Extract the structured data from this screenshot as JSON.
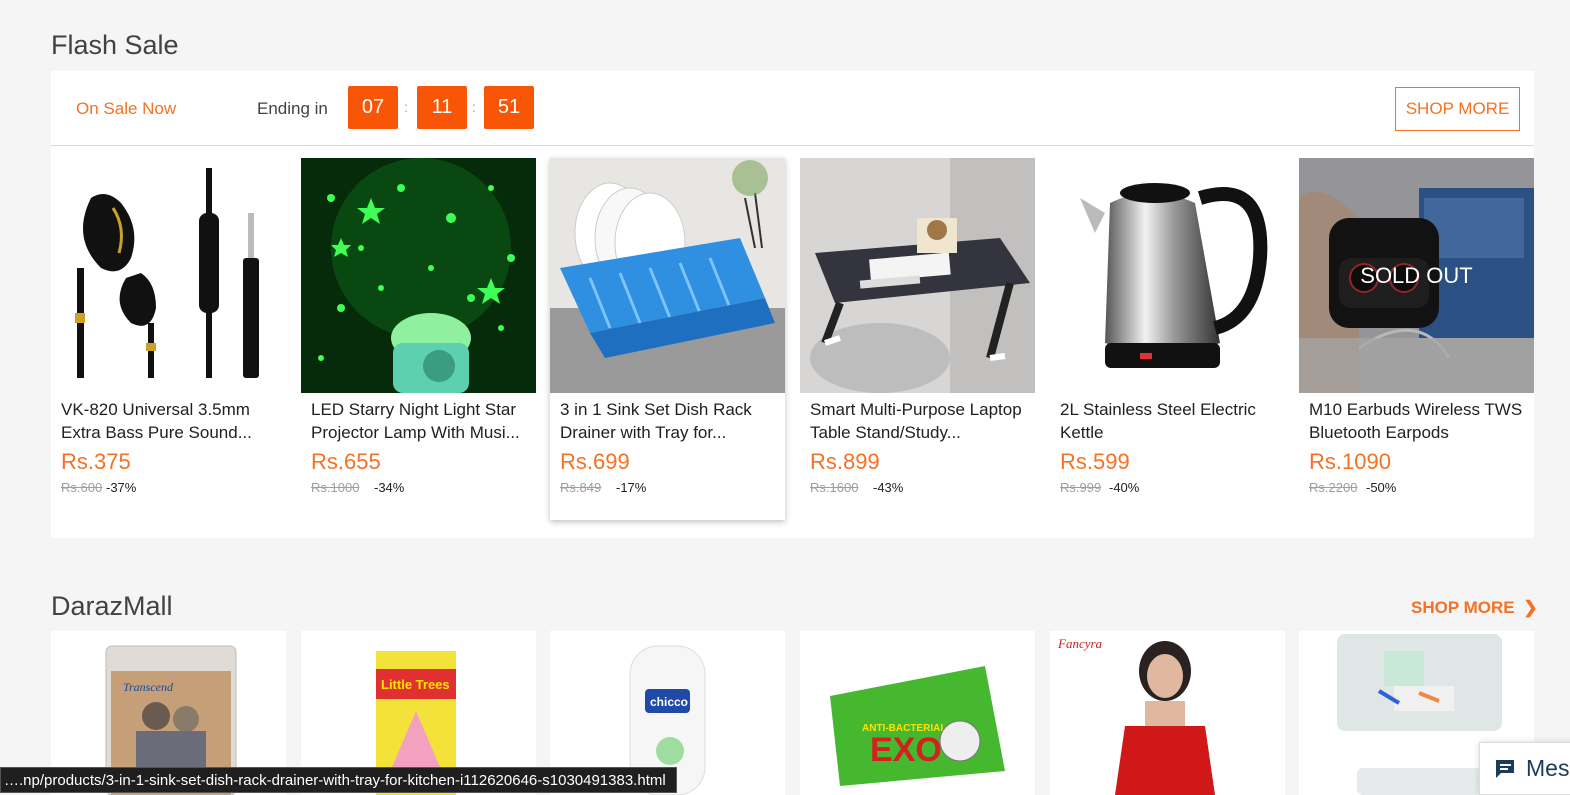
{
  "flash_sale": {
    "title": "Flash Sale",
    "on_sale_label": "On Sale Now",
    "ending_label": "Ending in",
    "timer": {
      "hours": "07",
      "minutes": "11",
      "seconds": "51",
      "separator": ":"
    },
    "shop_more_label": "SHOP MORE",
    "products": [
      {
        "name": "VK-820 Universal 3.5mm Extra Bass Pure Sound...",
        "price": "Rs.375",
        "original": "Rs.600",
        "discount": "-37%"
      },
      {
        "name": "LED Starry Night Light Star Projector Lamp With Musi...",
        "price": "Rs.655",
        "original": "Rs.1000",
        "discount": "-34%"
      },
      {
        "name": "3 in 1 Sink Set Dish Rack Drainer with Tray for...",
        "price": "Rs.699",
        "original": "Rs.849",
        "discount": "-17%"
      },
      {
        "name": "Smart Multi-Purpose Laptop Table Stand/Study...",
        "price": "Rs.899",
        "original": "Rs.1600",
        "discount": "-43%"
      },
      {
        "name": "2L Stainless Steel Electric Kettle",
        "price": "Rs.599",
        "original": "Rs.999",
        "discount": "-40%"
      },
      {
        "name": "M10 Earbuds Wireless TWS Bluetooth Earpods",
        "price": "Rs.1090",
        "original": "Rs.2200",
        "discount": "-50%",
        "badge": "SOLD OUT"
      }
    ]
  },
  "mall": {
    "title": "DarazMall",
    "shop_more_label": "SHOP MORE",
    "brand_texts": [
      "Transcend",
      "Little Trees",
      "chicco",
      "EXO",
      "ANTI-BACTERIAL",
      "Fancyra"
    ]
  },
  "status_url": "….np/products/3-in-1-sink-set-dish-rack-drainer-with-tray-for-kitchen-i112620646-s1030491383.html",
  "messages_label": "Mes",
  "colors": {
    "accent": "#f57224",
    "timer_bg": "#f85606"
  }
}
